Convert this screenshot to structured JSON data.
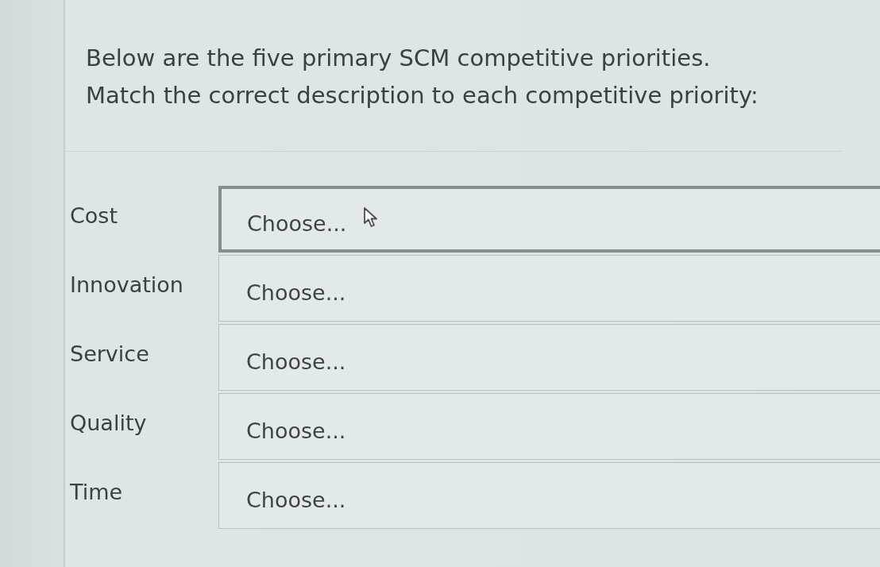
{
  "question": {
    "lines": [
      "Below are the five primary SCM competitive priorities.",
      "Match the correct description to each competitive priority:"
    ]
  },
  "matches": [
    {
      "label": "Cost",
      "value": "Choose...",
      "hovered": true
    },
    {
      "label": "Innovation",
      "value": "Choose...",
      "hovered": false
    },
    {
      "label": "Service",
      "value": "Choose...",
      "hovered": false
    },
    {
      "label": "Quality",
      "value": "Choose...",
      "hovered": false
    },
    {
      "label": "Time",
      "value": "Choose...",
      "hovered": false
    }
  ]
}
